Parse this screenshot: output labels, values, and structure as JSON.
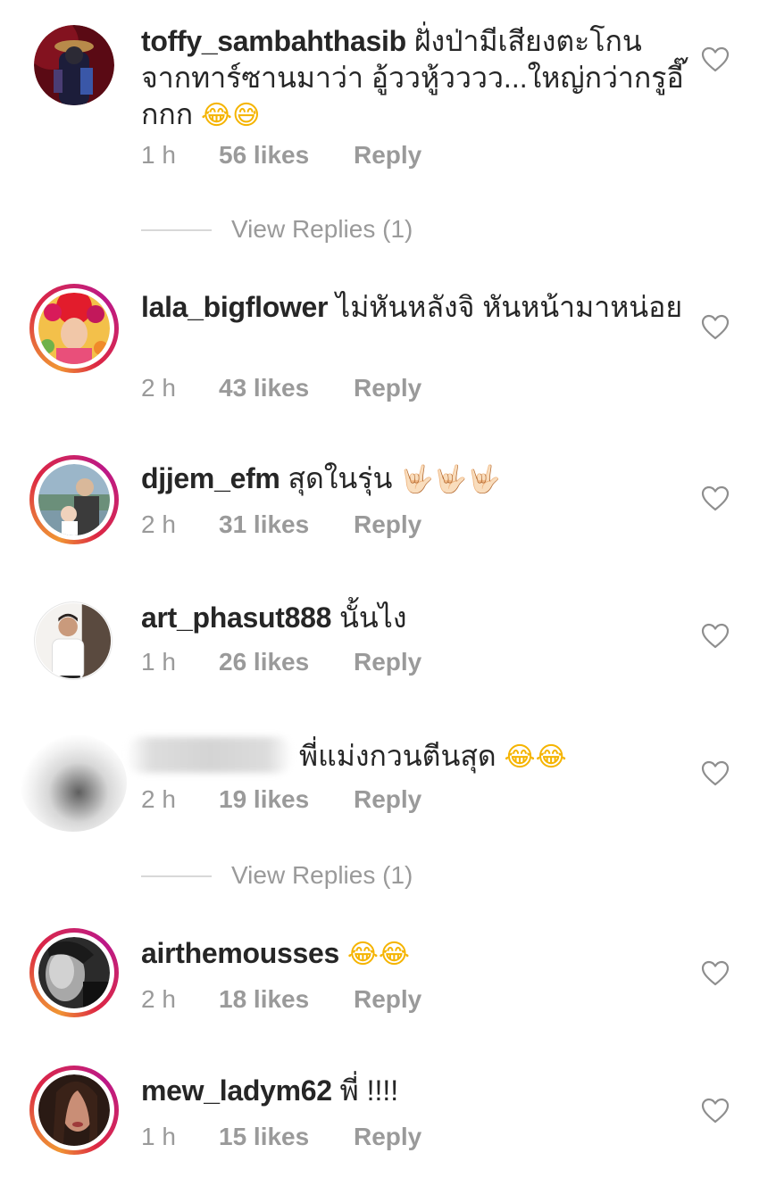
{
  "comments": [
    {
      "username": "toffy_sambahthasib",
      "text": "ฝั่งป่ามีเสียงตะโกนจากทาร์ซานมาว่า อู้ววหู้วววว...ใหญ่กว่ากรูอี๊กกก",
      "emoji": "😂😅",
      "time": "1 h",
      "likes": "56 likes",
      "reply": "Reply",
      "avatar": "dark-costume-photo"
    },
    {
      "username": "lala_bigflower",
      "text": "ไม่หันหลังจิ หันหน้ามาหน่อย",
      "emoji": "",
      "time": "2 h",
      "likes": "43 likes",
      "reply": "Reply",
      "avatar": "flower-crown-photo"
    },
    {
      "username": "djjem_efm",
      "text": "สุดในรุ่น",
      "emoji": "🤟🏻🤟🏻🤟🏻",
      "time": "2 h",
      "likes": "31 likes",
      "reply": "Reply",
      "avatar": "father-baby-photo"
    },
    {
      "username": "art_phasut888",
      "text": "นั้นไง",
      "emoji": "",
      "time": "1 h",
      "likes": "26 likes",
      "reply": "Reply",
      "avatar": "man-white-shirt-photo"
    },
    {
      "username": "",
      "text": "พี่แม่งกวนตีนสุด",
      "emoji": "😂😂",
      "time": "2 h",
      "likes": "19 likes",
      "reply": "Reply",
      "avatar": "blurred-avatar"
    },
    {
      "username": "airthemousses",
      "text": "",
      "emoji": "😂😂",
      "time": "2 h",
      "likes": "18 likes",
      "reply": "Reply",
      "avatar": "grayscale-portrait-photo"
    },
    {
      "username": "mew_ladym62",
      "text": "พี่ !!!!",
      "emoji": "",
      "time": "1 h",
      "likes": "15 likes",
      "reply": "Reply",
      "avatar": "woman-portrait-photo"
    }
  ],
  "view_replies": [
    {
      "label": "View Replies (1)"
    },
    {
      "label": "View Replies (1)"
    }
  ],
  "icons": {
    "like": "heart-outline-icon"
  },
  "colors": {
    "text": "#262626",
    "meta": "#9a9a9a",
    "story_ring_start": "#f09433",
    "story_ring_end": "#bc1888"
  }
}
